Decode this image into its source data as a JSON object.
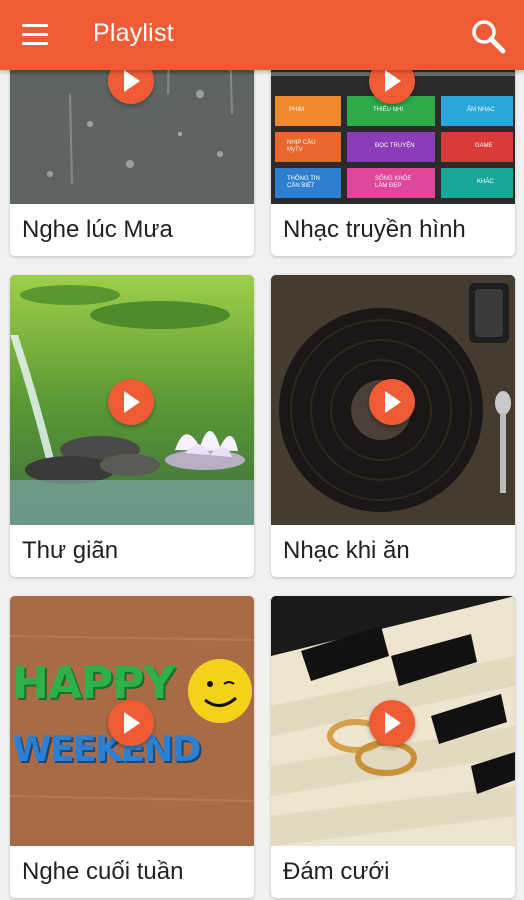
{
  "app": {
    "title": "Playlist",
    "accent_color": "#ef5b35",
    "icons": {
      "menu": "menu-icon",
      "search": "search-icon",
      "play": "play-icon"
    }
  },
  "tv_tiles": [
    "PHIM",
    "THIẾU NHI",
    "ÂM NHẠC",
    "NHỊP CẦU MyTV",
    "ĐỌC TRUYỆN",
    "GAME",
    "THÔNG TIN CẦN BIẾT",
    "SỐNG KHỎE LÀM ĐẸP",
    "KHÁC"
  ],
  "weekend_letters": [
    "HAPPY",
    "WEEKEND"
  ],
  "playlists": [
    {
      "label": "Nghe lúc Mưa"
    },
    {
      "label": "Nhạc truyền hình"
    },
    {
      "label": "Thư giãn"
    },
    {
      "label": "Nhạc khi ăn"
    },
    {
      "label": "Nghe cuối tuần"
    },
    {
      "label": "Đám cưới"
    }
  ]
}
